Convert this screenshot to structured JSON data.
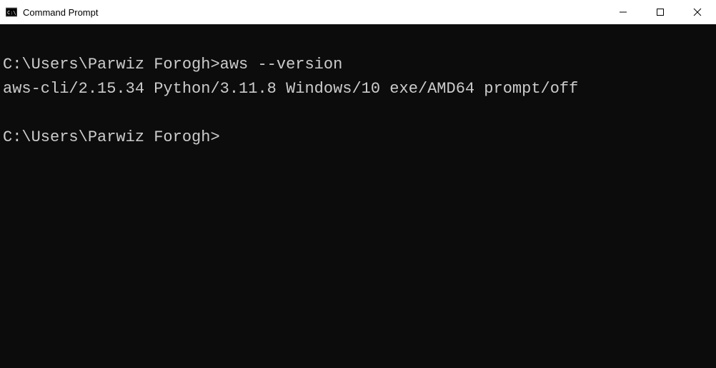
{
  "window": {
    "title": "Command Prompt"
  },
  "terminal": {
    "prompt1": "C:\\Users\\Parwiz Forogh>",
    "command1": "aws --version",
    "output1": "aws-cli/2.15.34 Python/3.11.8 Windows/10 exe/AMD64 prompt/off",
    "prompt2": "C:\\Users\\Parwiz Forogh>"
  }
}
